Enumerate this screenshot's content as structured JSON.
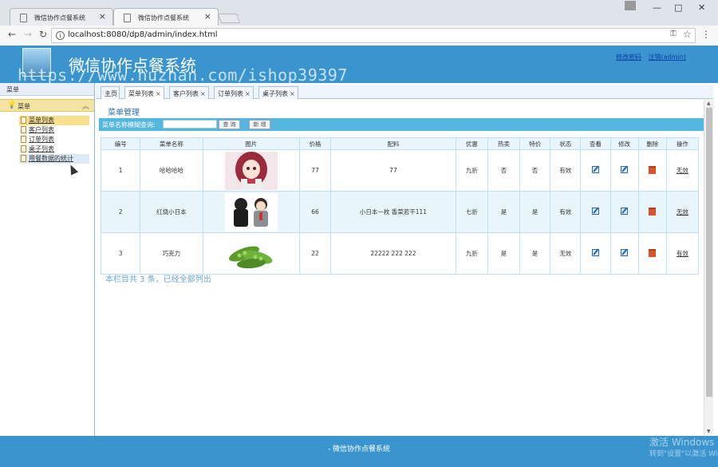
{
  "browser": {
    "tabs": [
      {
        "title": "微信协作点餐系统",
        "close": "×"
      },
      {
        "title": "微信协作点餐系统",
        "close": "×"
      }
    ],
    "url": "localhost:8080/dp8/admin/index.html",
    "controls": {
      "minimize": "—",
      "maximize": "□",
      "close": "✕"
    }
  },
  "header": {
    "title": "微信协作点餐系统",
    "links": [
      "修改密码",
      "注销(admin)"
    ],
    "watermark": "https://www.huzhan.com/ishop39397"
  },
  "sidebar": {
    "header": "菜单",
    "group": "菜单",
    "items": [
      "菜单列表",
      "客户列表",
      "订单列表",
      "桌子列表",
      "用餐数据的统计"
    ]
  },
  "content_tabs": [
    "主页",
    "菜单列表",
    "客户列表",
    "订单列表",
    "桌子列表"
  ],
  "panel": {
    "title": "菜单管理",
    "search_label": "菜单名称模糊查询:",
    "search_value": "",
    "query_button": "查 询",
    "add_button": "新 增",
    "columns": [
      "编号",
      "菜单名称",
      "图片",
      "价格",
      "配料",
      "优惠",
      "热卖",
      "特价",
      "状态",
      "查看",
      "修改",
      "删除",
      "操作"
    ],
    "rows": [
      {
        "id": "1",
        "name": "哈哈哈哈",
        "image": "anime-girl-image",
        "price": "77",
        "ingredients": "77",
        "discount": "九折",
        "hot": "否",
        "special": "否",
        "status": "有效",
        "action": "无效"
      },
      {
        "id": "2",
        "name": "红烧小日本",
        "image": "cartoon-characters-image",
        "price": "66",
        "ingredients": "小日本一枚 香菜若干111",
        "discount": "七折",
        "hot": "是",
        "special": "是",
        "status": "有效",
        "action": "无效"
      },
      {
        "id": "3",
        "name": "巧克力",
        "image": "green-peas-image",
        "price": "22",
        "ingredients": "22222 222 222",
        "discount": "九折",
        "hot": "是",
        "special": "是",
        "status": "无效",
        "action": "有效"
      }
    ],
    "total_text": "本栏目共 3 条，已经全部列出"
  },
  "footer": {
    "text": "- 微信协作点餐系统"
  },
  "os_overlay": {
    "line1": "激活 Windows",
    "line2": "转到\"设置\"以激活 Windows。"
  }
}
